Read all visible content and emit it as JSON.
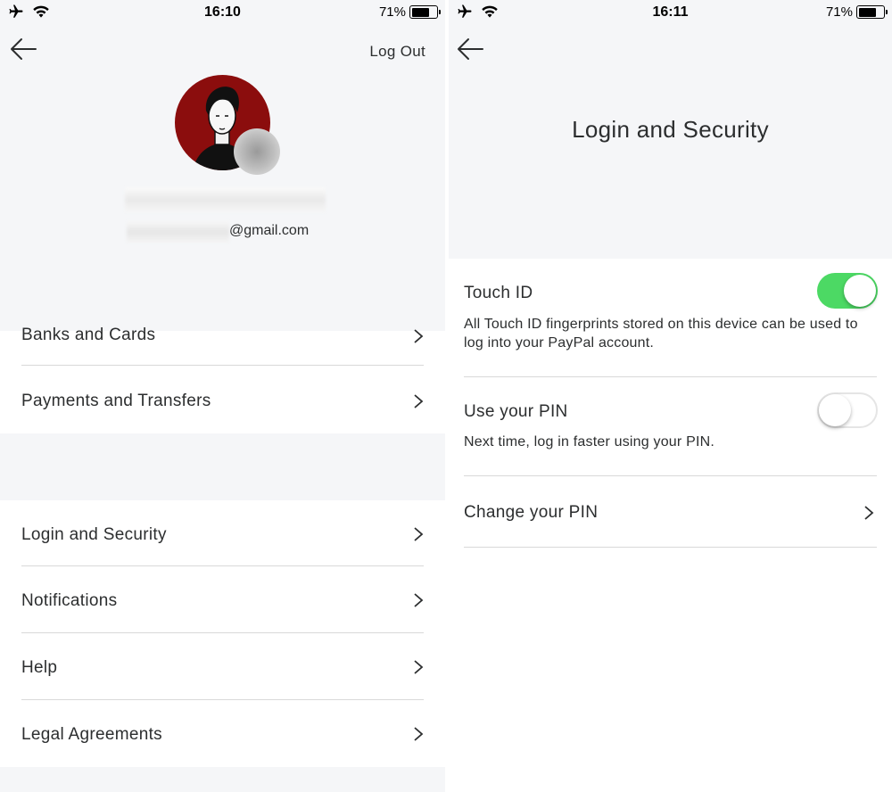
{
  "left": {
    "status": {
      "time": "16:10",
      "battery": "71%"
    },
    "header": {
      "logout_label": "Log Out",
      "email_domain": "@gmail.com"
    },
    "menu_group1": [
      {
        "label": "Banks and Cards"
      },
      {
        "label": "Payments and Transfers"
      }
    ],
    "menu_group2": [
      {
        "label": "Login and Security"
      },
      {
        "label": "Notifications"
      },
      {
        "label": "Help"
      },
      {
        "label": "Legal Agreements"
      }
    ]
  },
  "right": {
    "status": {
      "time": "16:11",
      "battery": "71%"
    },
    "title": "Login and Security",
    "touch_id": {
      "title": "Touch ID",
      "description": "All Touch ID fingerprints stored on this device can be used to log into your PayPal account.",
      "enabled": true
    },
    "use_pin": {
      "title": "Use your PIN",
      "description": "Next time, log in faster using your PIN.",
      "enabled": false
    },
    "change_pin": {
      "label": "Change your PIN"
    }
  },
  "colors": {
    "toggle_on": "#4cd964",
    "header_bg": "#f5f6f8",
    "avatar_bg": "#8b0d0d"
  },
  "icons": [
    "airplane-icon",
    "wifi-icon",
    "battery-icon",
    "back-arrow-icon",
    "chevron-right-icon"
  ]
}
